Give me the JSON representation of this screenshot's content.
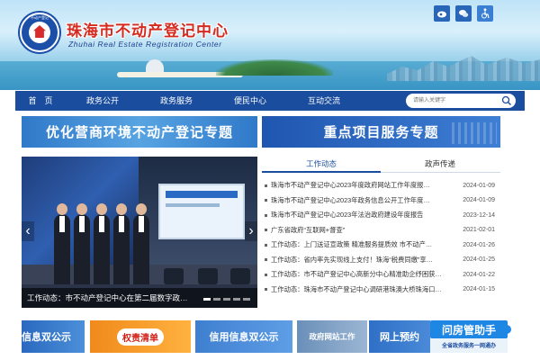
{
  "header": {
    "title": "珠海市不动产登记中心",
    "subtitle": "Zhuhai Real Estate Registration Center",
    "emblem_text": "不动产登记",
    "icons": [
      "weibo-icon",
      "wechat-icon",
      "accessibility-icon"
    ]
  },
  "nav": {
    "items": [
      "首　页",
      "政务公开",
      "政务服务",
      "便民中心",
      "互动交流"
    ],
    "search_placeholder": "请输入关键字"
  },
  "features": {
    "left": "优化营商环境不动产登记专题",
    "right": "重点项目服务专题"
  },
  "carousel": {
    "caption": "工作动态：市不动产登记中心在第二届数字政…",
    "slide_count": 5,
    "active_slide": 1
  },
  "news": {
    "tabs": [
      "工作动态",
      "政声传递"
    ],
    "active_tab": 0,
    "items": [
      {
        "title": "珠海市不动产登记中心2023年度政府网站工作年度报…",
        "date": "2024-01-09"
      },
      {
        "title": "珠海市不动产登记中心2023年政务信息公开工作年度…",
        "date": "2024-01-09"
      },
      {
        "title": "珠海市不动产登记中心2023年法治政府建设年度报告",
        "date": "2023-12-14"
      },
      {
        "title": "广东省政府“互联网+督查”",
        "date": "2021-02-01"
      },
      {
        "title": "工作动态：上门送证宣政策 精准服务提质效 市不动产…",
        "date": "2024-01-26"
      },
      {
        "title": "工作动态：省内率先实现线上支付！珠海“税费同缴”享…",
        "date": "2024-01-25"
      },
      {
        "title": "工作动态：市不动产登记中心高新分中心精准助企纾困获…",
        "date": "2024-01-22"
      },
      {
        "title": "工作动态：珠海市不动产登记中心调研港珠澳大桥珠海口…",
        "date": "2024-01-15"
      }
    ]
  },
  "tiles": {
    "t1": "信息双公示",
    "t2": "权责清单",
    "t3": "信用信息双公示",
    "t4": "政府网站工作",
    "t5": "网上预约",
    "t6": "全省政务服务一网通办"
  },
  "assistant": {
    "label": "问房管助手"
  }
}
